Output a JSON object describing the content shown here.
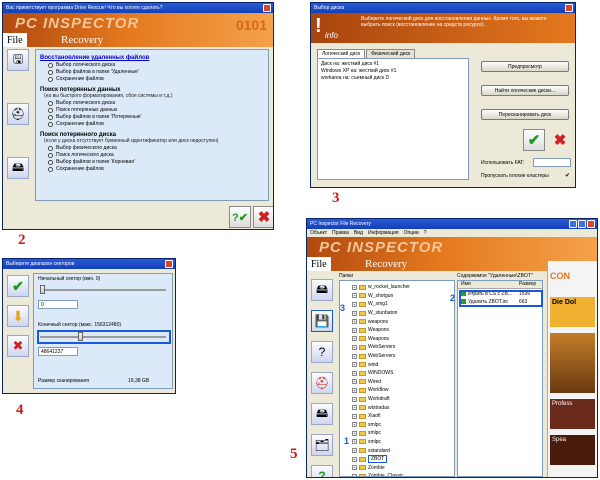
{
  "step_labels": [
    "2",
    "3",
    "4",
    "5"
  ],
  "blue_labels": [
    "3",
    "2",
    "1"
  ],
  "w2": {
    "title": "Вас приветствует программа Drive Rescue! Что вы хотите сделать?",
    "brand": "PC INSPECTOR",
    "fr_left": "File",
    "fr_right": "Recovery",
    "sections": [
      {
        "title": "Восстановление удаленных файлов",
        "note": "",
        "options": [
          "Выбор логического диска",
          "Выбор файлов в папке 'Удаленные'",
          "Сохранение файлов"
        ]
      },
      {
        "title": "Поиск потерянных данных",
        "note": "(на вы быстрого форматирования, сбоя системы и т.д.)",
        "options": [
          "Выбор логического диска",
          "Поиск потерянных данных",
          "Выбор файлов в папке 'Потерянные'",
          "Сохранение файлов"
        ]
      },
      {
        "title": "Поиск потерянного диска",
        "note": "(если у диска отсутствует буквенный идентификатор или диск недоступен)",
        "options": [
          "Выбор физического диска",
          "Поиск логического диска",
          "Выбор файлов в папке 'Корневая'",
          "Сохранение файлов"
        ]
      }
    ]
  },
  "w3": {
    "title": "Выбор диска",
    "info_text": "Выберите логический диск для восстановления данных. Кроме того, вы можете выбрать поиск (восстановление на средств ресурсе).",
    "info_label": "info",
    "tabs": [
      "Логический диск",
      "Физический диск"
    ],
    "disks": [
      "Диск  на: жесткий диск #1",
      "Windows XP  на: жесткий диск #1",
      "workarea  на: съемный диск D"
    ],
    "buttons": [
      "Предпросмотр",
      "Найти логические диски...",
      "Пересканировать диск"
    ],
    "fat_label": "Использовать FAT:",
    "skip_label": "Пропускать плохие кластеры"
  },
  "w4": {
    "title": "Выберите диапазон секторов",
    "start_label": "Начальный сектор (мин. 0)",
    "start_value": "0",
    "end_label": "Конечный сектор (макс. 156312480)",
    "end_value": "48641237",
    "size_label": "Размер сканирования",
    "size_value": "19,38 GB",
    "start_level": 0.0,
    "end_level": 0.31
  },
  "w5": {
    "title": "PC Inspector File Recovery",
    "menu": [
      "Объект",
      "Правка",
      "Вид",
      "Информация",
      "Опции",
      "?"
    ],
    "brand": "PC INSPECTOR",
    "fr_left": "File",
    "fr_right": "Recovery",
    "tree_header": "Папки",
    "tree": [
      "w_rocket_launcher",
      "W_shotgun",
      "W_smg1",
      "W_stunbaton",
      "weapons",
      "Weapons",
      "Weapons",
      "WebServers",
      "WebServers",
      "wind",
      "WINDOWS",
      "Wired",
      "Workflow",
      "Workdraft",
      "wtstradas",
      "Xiaofi",
      "xmlpc",
      "xmlpc",
      "xmlpc",
      "xstandard",
      "ZBOT",
      "Zombie",
      "Zombie_Classic",
      "Zombie_Fast"
    ],
    "tree_selected_index": 20,
    "content_header": "Содержимое \"Удаленные\\ZBOT\"",
    "col_name": "Имя",
    "col_size": "Размер",
    "files": [
      {
        "name": "Играть в CS с ZB...",
        "size": "1536"
      },
      {
        "name": "Удалить ZBOT.ini",
        "size": "663"
      }
    ],
    "ads": [
      "CON",
      "Die Dol",
      "Profess",
      "Spea"
    ]
  },
  "colors": {
    "accent": "#1a5ad8",
    "step": "#d01818",
    "banner": "#e4781e"
  }
}
